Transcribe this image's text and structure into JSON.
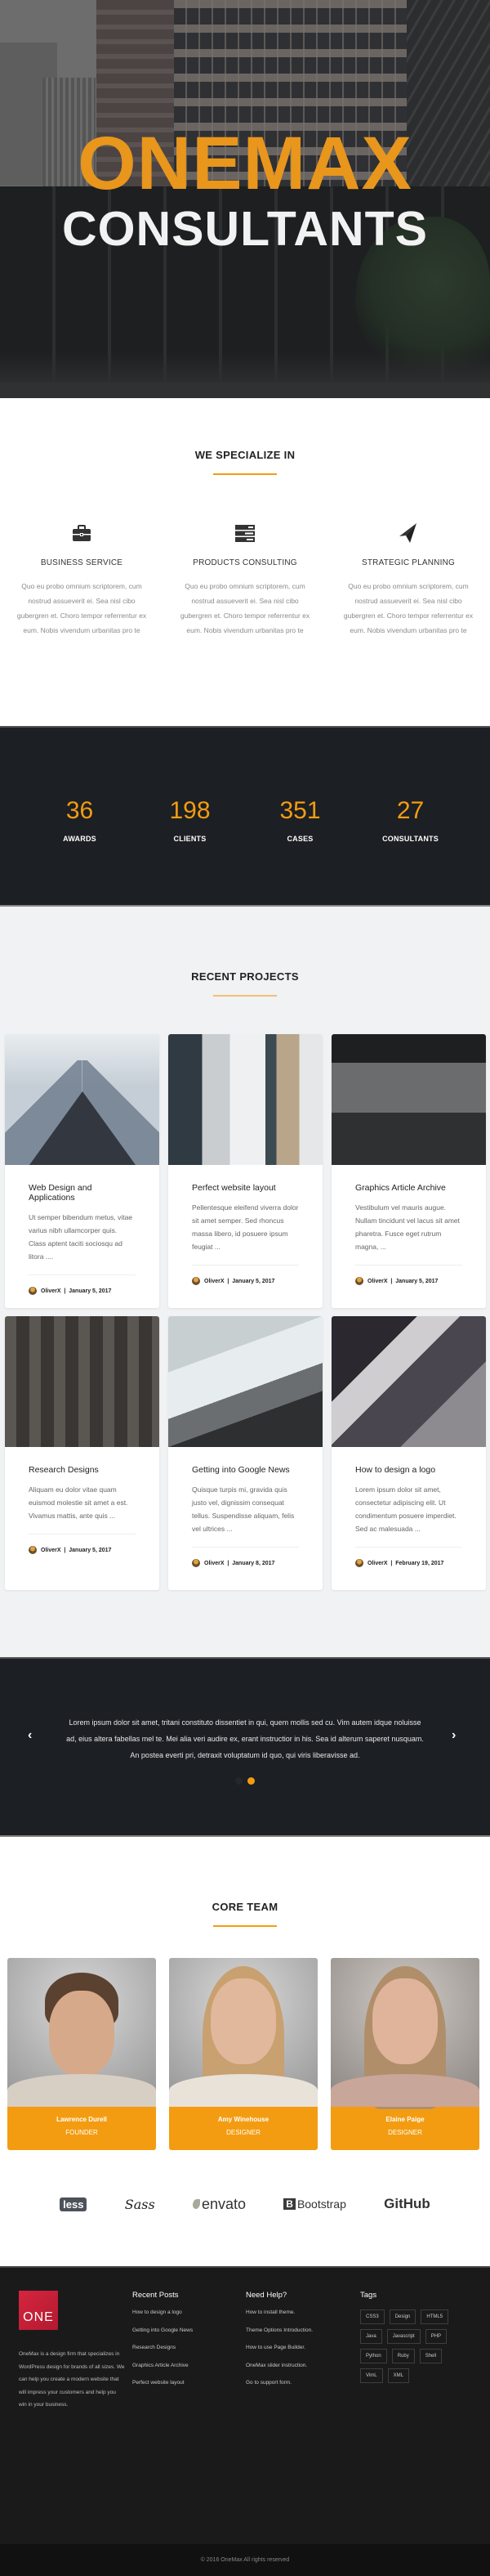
{
  "hero": {
    "title_line1": "ONEMAX",
    "title_line2": "CONSULTANTS"
  },
  "specialize": {
    "title": "WE SPECIALIZE IN",
    "services": [
      {
        "icon": "briefcase-icon",
        "title": "BUSINESS SERVICE",
        "text": "Quo eu probo omnium scriptorem, cum nostrud assueverit ei. Sea nisl cibo gubergren et. Choro tempor referrentur ex eum. Nobis vivendum urbanitas pro te"
      },
      {
        "icon": "server-icon",
        "title": "PRODUCTS CONSULTING",
        "text": "Quo eu probo omnium scriptorem, cum nostrud assueverit ei. Sea nisl cibo gubergren et. Choro tempor referrentur ex eum. Nobis vivendum urbanitas pro te"
      },
      {
        "icon": "paper-plane-icon",
        "title": "STRATEGIC PLANNING",
        "text": "Quo eu probo omnium scriptorem, cum nostrud assueverit ei. Sea nisl cibo gubergren et. Choro tempor referrentur ex eum. Nobis vivendum urbanitas pro te"
      }
    ]
  },
  "stats": [
    {
      "value": "36",
      "label": "AWARDS"
    },
    {
      "value": "198",
      "label": "CLIENTS"
    },
    {
      "value": "351",
      "label": "CASES"
    },
    {
      "value": "27",
      "label": "CONSULTANTS"
    }
  ],
  "projects": {
    "title": "RECENT PROJECTS",
    "items": [
      {
        "title": "Web Design and Applications",
        "excerpt": "Ut semper bibendum metus, vitae varius nibh ullamcorper quis. Class aptent taciti sociosqu ad litora ....",
        "author": "OliverX",
        "date": "January 5, 2017"
      },
      {
        "title": "Perfect website layout",
        "excerpt": "Pellentesque eleifend viverra dolor sit amet semper. Sed rhoncus massa libero, id posuere ipsum feugiat ...",
        "author": "OliverX",
        "date": "January 5, 2017"
      },
      {
        "title": "Graphics Article Archive",
        "excerpt": "Vestibulum vel mauris augue. Nullam tincidunt vel lacus sit amet pharetra. Fusce eget rutrum magna, ...",
        "author": "OliverX",
        "date": "January 5, 2017"
      },
      {
        "title": "Research Designs",
        "excerpt": "Aliquam eu dolor vitae quam euismod molestie sit amet a est. Vivamus mattis, ante quis ...",
        "author": "OliverX",
        "date": "January 5, 2017"
      },
      {
        "title": "Getting into Google News",
        "excerpt": "Quisque turpis mi, gravida quis justo vel, dignissim consequat tellus. Suspendisse aliquam, felis vel ultrices ...",
        "author": "OliverX",
        "date": "January 8, 2017"
      },
      {
        "title": "How to design a logo",
        "excerpt": "Lorem ipsum dolor sit amet, consectetur adipiscing elit. Ut condimentum posuere imperdiet. Sed ac malesuada ...",
        "author": "OliverX",
        "date": "February 19, 2017"
      }
    ],
    "meta_separator": "|"
  },
  "testimonial": {
    "quote": "Lorem ipsum dolor sit amet, tritani constituto dissentiet in qui, quem mollis sed cu. Vim autem idque noluisse ad, eius altera fabellas mel te. Mei alia veri audire ex, erant instructior in his. Sea id alterum saperet nusquam. An postea everti pri, detraxit voluptatum id quo, qui viris liberavisse ad.",
    "prev": "‹",
    "next": "›",
    "slide_count": 2,
    "active_slide": 2
  },
  "team": {
    "title": "CORE TEAM",
    "members": [
      {
        "name": "Lawrence Durell",
        "role": "FOUNDER"
      },
      {
        "name": "Amy Winehouse",
        "role": "DESIGNER"
      },
      {
        "name": "Elaine Paige",
        "role": "DESIGNER"
      }
    ]
  },
  "logos": [
    "less",
    "Sass",
    "envato",
    "Bootstrap",
    "GitHub"
  ],
  "footer": {
    "logo_text": "ONE",
    "about": "OneMax is a design firm that specializes in WordPress design for brands of all sizes. We can help you create a modern website that will impress your customers and help you win in your business.",
    "recent_posts": {
      "title": "Recent Posts",
      "items": [
        "How to design a logo",
        "Getting into Google News",
        "Research Designs",
        "Graphics Article Archive",
        "Perfect website layout"
      ]
    },
    "help": {
      "title": "Need Help?",
      "items": [
        "How to install theme.",
        "Theme Options Introduction.",
        "How to use Page Builder.",
        "OneMax slider instruction.",
        "Go to support form."
      ]
    },
    "tags": {
      "title": "Tags",
      "items": [
        "CSS3",
        "Design",
        "HTML5",
        "Java",
        "Javascript",
        "PHP",
        "Python",
        "Ruby",
        "Shell",
        "VimL",
        "XML"
      ]
    },
    "copyright": "© 2016 OneMax All rights reserved"
  },
  "colors": {
    "accent": "#f39c12",
    "dark": "#1c1f23",
    "footer": "#1a1a1a",
    "brand_red": "#d5253e"
  }
}
